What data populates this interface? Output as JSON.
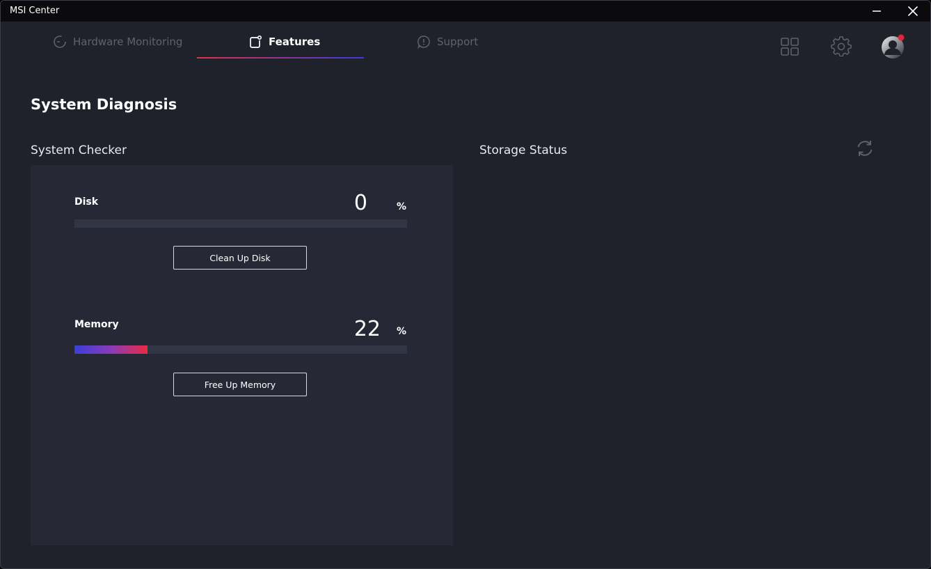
{
  "window": {
    "title": "MSI Center"
  },
  "nav": {
    "tabs": [
      {
        "label": "Hardware Monitoring",
        "icon": "gauge-icon",
        "active": false
      },
      {
        "label": "Features",
        "icon": "features-icon",
        "active": true
      },
      {
        "label": "Support",
        "icon": "support-chat-icon",
        "active": false
      }
    ],
    "right_icons": [
      "apps-grid-icon",
      "settings-gear-icon",
      "user-avatar"
    ],
    "avatar_notification": true
  },
  "page": {
    "title": "System Diagnosis"
  },
  "system_checker": {
    "title": "System Checker",
    "items": [
      {
        "label": "Disk",
        "value": "0",
        "unit": "%",
        "percent": 0,
        "button": "Clean Up Disk"
      },
      {
        "label": "Memory",
        "value": "22",
        "unit": "%",
        "percent": 22,
        "button": "Free Up Memory"
      }
    ]
  },
  "storage_status": {
    "title": "Storage Status",
    "refresh_icon": "refresh-icon"
  },
  "colors": {
    "background": "#1f222b",
    "panel": "#262935",
    "accent_start": "#3b3fd8",
    "accent_end": "#ea2a45",
    "notification": "#e3253c"
  }
}
